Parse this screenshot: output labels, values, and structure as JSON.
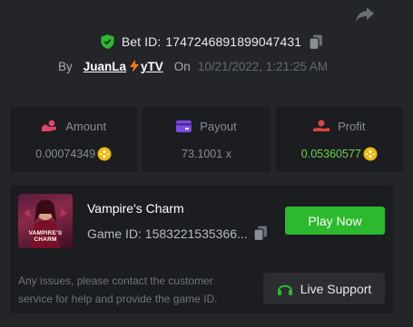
{
  "header": {
    "bet_label": "Bet ID:",
    "bet_id": "1747246891899047431",
    "by_label": "By",
    "username": "JuanLa",
    "username_suffix": "yTV",
    "on_label": "On",
    "datetime": "10/21/2022, 1:21:25 AM"
  },
  "stats": [
    {
      "label": "Amount",
      "value": "0.00074349",
      "icon": "amount-icon",
      "color": "#e0456e"
    },
    {
      "label": "Payout",
      "value": "73.1001 x",
      "icon": "payout-icon",
      "color": "#7b4de0"
    },
    {
      "label": "Profit",
      "value": "0.05360577",
      "icon": "profit-icon",
      "color": "#e04343"
    }
  ],
  "game": {
    "name": "Vampire's Charm",
    "id_text": "Game ID: 1583221535366...",
    "thumb_title_1": "VAMPIRE'S",
    "thumb_title_2": "CHARM",
    "play_label": "Play Now"
  },
  "support": {
    "help_text": "Any issues, please contact the customer service for help and provide the game ID.",
    "button_label": "Live Support"
  },
  "colors": {
    "accent_green": "#2db92d",
    "profit_green": "#6fd34a",
    "coin": "#f0b90b",
    "background": "#232528",
    "panel": "#1b1d20"
  }
}
